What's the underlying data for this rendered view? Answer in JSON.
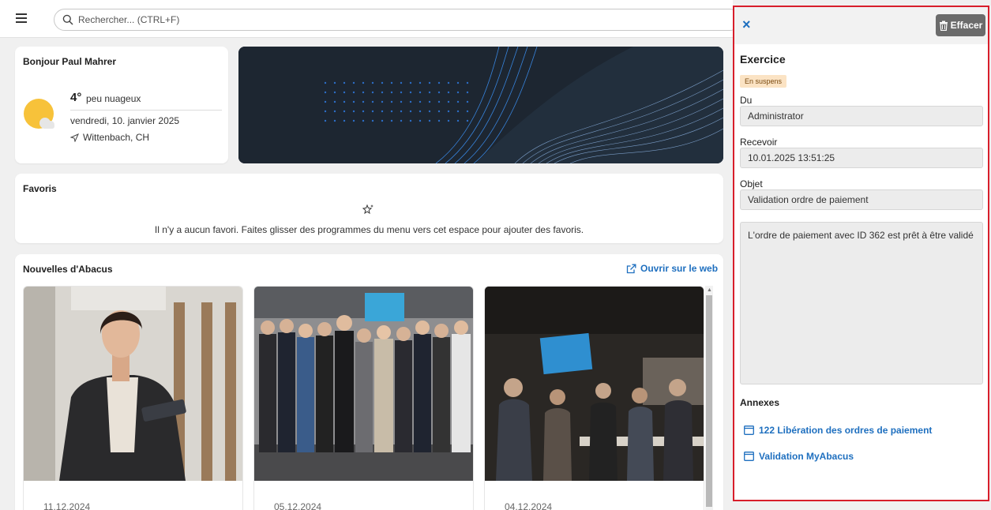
{
  "topbar": {
    "search_placeholder": "Rechercher... (CTRL+F)"
  },
  "greeting": {
    "title": "Bonjour Paul Mahrer",
    "temperature": "4°",
    "condition": "peu nuageux",
    "date": "vendredi, 10. janvier 2025",
    "location": "Wittenbach, CH"
  },
  "favorites": {
    "title": "Favoris",
    "empty_message": "Il n'y a aucun favori. Faites glisser des programmes du menu vers cet espace pour ajouter des favoris."
  },
  "news": {
    "title": "Nouvelles d'Abacus",
    "open_web_label": "Ouvrir sur le web",
    "items": [
      {
        "date": "11.12.2024"
      },
      {
        "date": "05.12.2024"
      },
      {
        "date": "04.12.2024"
      }
    ]
  },
  "panel": {
    "delete_label": "Effacer",
    "title": "Exercice",
    "status": "En suspens",
    "from_label": "Du",
    "from_value": "Administrator",
    "received_label": "Recevoir",
    "received_value": "10.01.2025 13:51:25",
    "subject_label": "Objet",
    "subject_value": "Validation ordre de paiement",
    "message": "L'ordre de paiement avec ID 362 est prêt à être validé",
    "attachments_label": "Annexes",
    "attachments": [
      {
        "label": "122 Libération des ordres de paiement"
      },
      {
        "label": "Validation MyAbacus"
      }
    ]
  },
  "colors": {
    "accent": "#1e6fbf",
    "highlight_border": "#d81e2b",
    "status_badge_bg": "#fbe3c4",
    "sun": "#f7c23a"
  }
}
